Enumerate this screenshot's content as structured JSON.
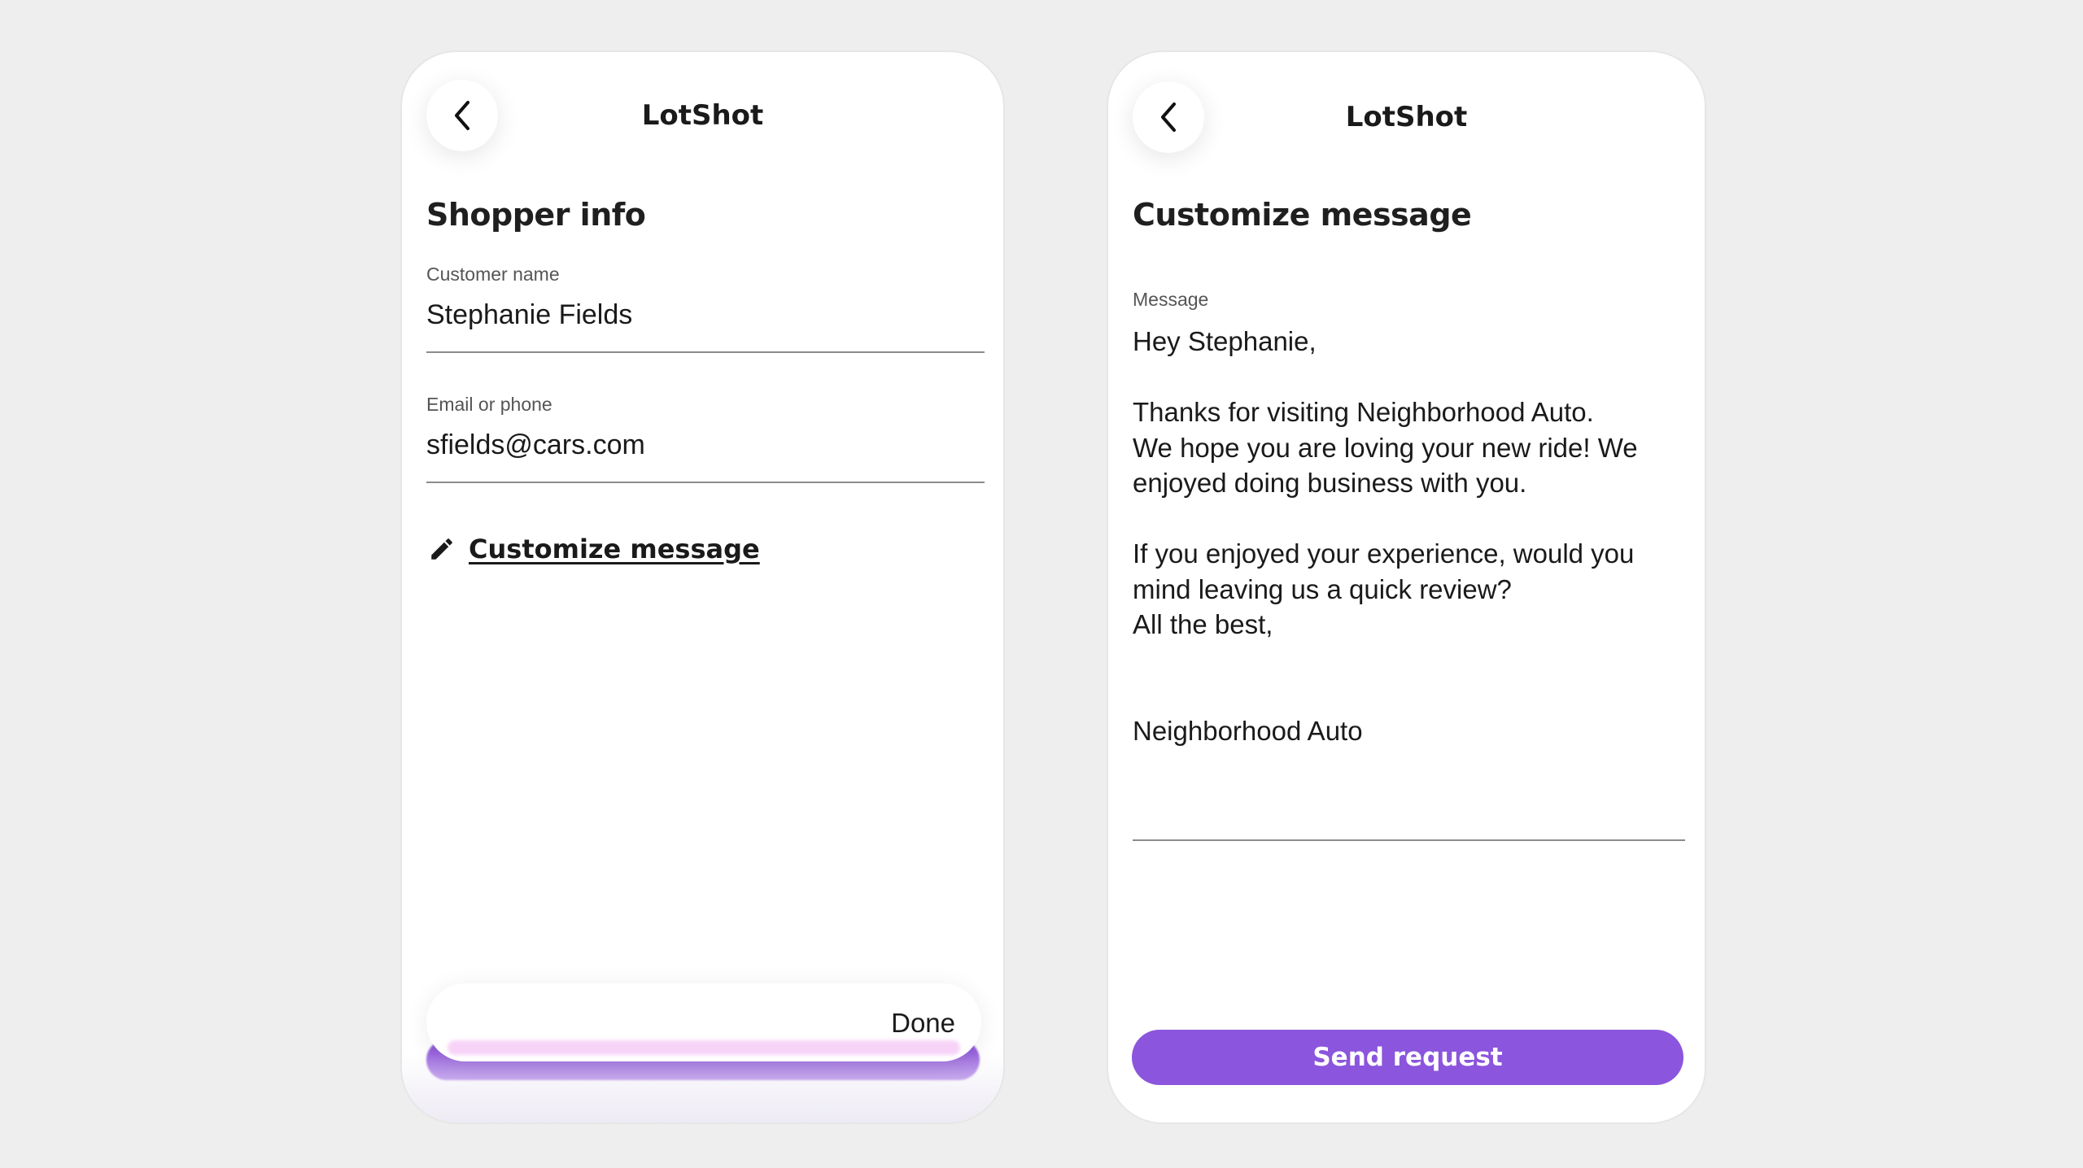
{
  "app": {
    "title": "LotShot"
  },
  "shopper_screen": {
    "title": "Shopper info",
    "customer_name": {
      "label": "Customer name",
      "value": "Stephanie Fields"
    },
    "email_or_phone": {
      "label": "Email or phone",
      "value": "sfields@cars.com"
    },
    "customize_link": "Customize message",
    "done_label": "Done"
  },
  "message_screen": {
    "title": "Customize message",
    "message_label": "Message",
    "message_paragraphs": [
      "Hey Stephanie,",
      "Thanks for visiting Neighborhood Auto.\nWe hope you are loving your new ride! We\nenjoyed doing business with you.",
      "If you enjoyed your experience, would you\nmind leaving us a quick review?",
      "All the best,",
      "Neighborhood Auto"
    ],
    "send_button": "Send request"
  },
  "colors": {
    "accent": "#8b55dd",
    "background": "#eeeeee",
    "card": "#ffffff"
  }
}
